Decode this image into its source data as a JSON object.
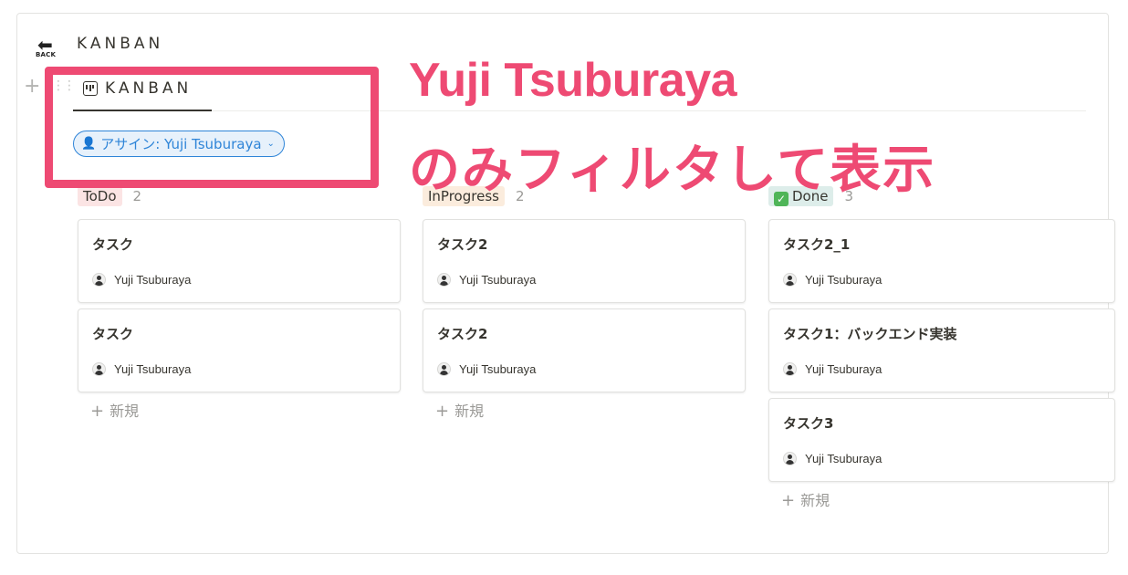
{
  "page": {
    "back_arrow": "⬅",
    "back_label": "BACK",
    "title": "KANBAN"
  },
  "toolbar": {
    "add_symbol": "+",
    "drag_symbol": "⋮⋮",
    "view_label": "KANBAN",
    "filter_icon": "👤",
    "filter_label": "アサイン: Yuji Tsuburaya",
    "filter_chevron": "⌄"
  },
  "annotation": {
    "line1": "Yuji Tsuburaya",
    "line2": "のみフィルタして表示",
    "color": "#ee4a73"
  },
  "columns": [
    {
      "status": "ToDo",
      "tag_color": "#fbe4e4",
      "count": "2",
      "cards": [
        {
          "title": "タスク",
          "assignee": "Yuji Tsuburaya"
        },
        {
          "title": "タスク",
          "assignee": "Yuji Tsuburaya"
        }
      ],
      "new_label": "新規"
    },
    {
      "status": "InProgress",
      "tag_color": "#fbecdd",
      "count": "2",
      "cards": [
        {
          "title": "タスク2",
          "assignee": "Yuji Tsuburaya"
        },
        {
          "title": "タスク2",
          "assignee": "Yuji Tsuburaya"
        }
      ],
      "new_label": "新規"
    },
    {
      "status": "Done",
      "status_icon": "✓",
      "tag_color": "#ddedea",
      "count": "3",
      "cards": [
        {
          "title": "タスク2_1",
          "assignee": "Yuji Tsuburaya"
        },
        {
          "title": "タスク1：バックエンド実装",
          "assignee": "Yuji Tsuburaya"
        },
        {
          "title": "タスク3",
          "assignee": "Yuji Tsuburaya"
        }
      ],
      "new_label": "新規"
    }
  ],
  "new_symbol": "+"
}
